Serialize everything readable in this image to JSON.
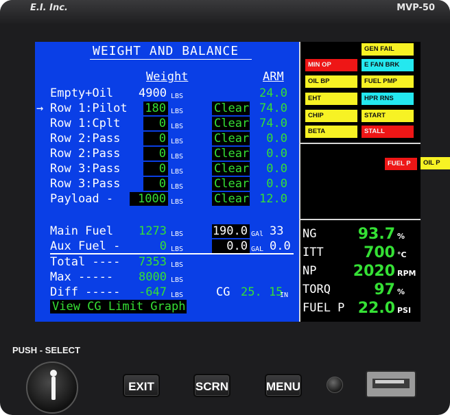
{
  "device": {
    "brand_left": "E.I. Inc.",
    "brand_right": "MVP-50",
    "push_select_label": "PUSH - SELECT",
    "buttons": {
      "exit": "EXIT",
      "scrn": "SCRN",
      "menu": "MENU"
    }
  },
  "wb": {
    "title": "WEIGHT AND BALANCE",
    "col_weight": "Weight",
    "col_arm": "ARM",
    "weight_unit": "LBS",
    "clear_label": "Clear",
    "empty_label": "Empty+Oil",
    "empty_weight": "4900",
    "empty_arm": "24.0",
    "pointer": "→",
    "rows": [
      {
        "label": "Row 1:Pilot",
        "weight": "180",
        "arm": "74.0"
      },
      {
        "label": "Row 1:Cplt",
        "weight": "0",
        "arm": "74.0"
      },
      {
        "label": "Row 2:Pass",
        "weight": "0",
        "arm": "0.0"
      },
      {
        "label": "Row 2:Pass",
        "weight": "0",
        "arm": "0.0"
      },
      {
        "label": "Row 3:Pass",
        "weight": "0",
        "arm": "0.0"
      },
      {
        "label": "Row 3:Pass",
        "weight": "0",
        "arm": "0.0"
      }
    ],
    "payload_label": "Payload -",
    "payload_weight": "1000",
    "payload_arm": "12.0",
    "main_fuel_label": "Main Fuel",
    "main_fuel_lbs": "1273",
    "main_fuel_gal_value": "190.0",
    "main_fuel_gal_unit": "GAl",
    "main_fuel_gal_other": "33",
    "aux_fuel_label": "Aux Fuel -",
    "aux_fuel_lbs": "0",
    "aux_fuel_gal_value": "0.0",
    "aux_fuel_gal_unit": "GAL",
    "aux_fuel_gal_other": "0.0",
    "total_label": "Total ----",
    "total_value": "7353",
    "max_label": "Max -----",
    "max_value": "8000",
    "diff_label": "Diff -----",
    "diff_value": "-647",
    "cg_label": "CG",
    "cg_value": "25. 15",
    "cg_unit": "IN",
    "view_graph_label": "View CG Limit Graph"
  },
  "annunciators": [
    {
      "label": "GEN FAIL",
      "color": "#f7f224"
    },
    {
      "label": "MIN OP",
      "color": "#ee1616"
    },
    {
      "label": "E FAN BRK",
      "color": "#24e8ef"
    },
    {
      "label": "OIL BP",
      "color": "#f7f224"
    },
    {
      "label": "FUEL PMP",
      "color": "#f7f224"
    },
    {
      "label": "EHT",
      "color": "#f7f224"
    },
    {
      "label": "HPR RNS",
      "color": "#24e8ef"
    },
    {
      "label": "CHIP",
      "color": "#f7f224"
    },
    {
      "label": "START",
      "color": "#f7f224"
    },
    {
      "label": "BETA",
      "color": "#f7f224"
    },
    {
      "label": "STALL",
      "color": "#ee1616"
    }
  ],
  "warnings": [
    {
      "label": "FUEL P",
      "color": "#ee1616"
    },
    {
      "label": "OIL P",
      "color": "#f7f224"
    }
  ],
  "engine": [
    {
      "label": "NG",
      "value": "93.7",
      "unit": "%"
    },
    {
      "label": "ITT",
      "value": "700",
      "unit": "°C"
    },
    {
      "label": "NP",
      "value": "2020",
      "unit": "RPM"
    },
    {
      "label": "TORQ",
      "value": "97",
      "unit": "%"
    },
    {
      "label": "FUEL P",
      "value": "22.0",
      "unit": "PSI"
    }
  ]
}
